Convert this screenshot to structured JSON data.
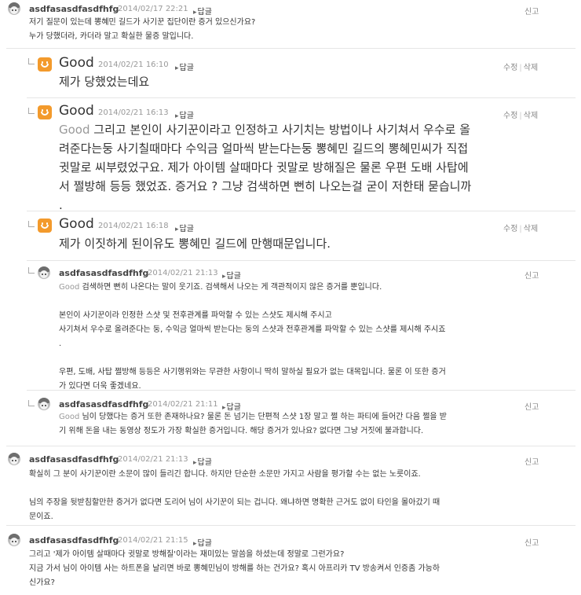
{
  "comments": [
    {
      "nick": "asdfasasdfasdfhfg",
      "date": "2014/02/17 22:21",
      "reply": "답글",
      "report": "신고",
      "lines": [
        "저기 질문이 있는데 뽕혜민 길드가 사기꾼 집단이란 증거 있으신가요?",
        "누가 당했더라, 카더라 말고 확실한 물증 말입니다."
      ]
    },
    {
      "nick": "Good",
      "date": "2014/02/21 16:10",
      "reply": "답글",
      "edit": "수정",
      "delete": "삭제",
      "lines": [
        "제가 당했었는데요"
      ]
    },
    {
      "nick": "Good",
      "date": "2014/02/21 16:13",
      "reply": "답글",
      "edit": "수정",
      "delete": "삭제",
      "mention": "Good",
      "lines": [
        " 그리고 본인이 사기꾼이라고 인정하고 사기치는 방법이나 사기쳐서 우수로 올",
        "려준다는둥 사기칠때마다 수익금 얼마씩 받는다는둥 뽕혜민 길드의 뽕혜민씨가 직접",
        "귓말로 씨부렸었구요. 제가 아이템 살때마다 귓말로 방해질은 물론 우편 도배 사탑에",
        "서 쩔방해 등등 했었죠. 증거요 ? 그냥 검색하면 뻔히 나오는걸 굳이 저한태 묻습니까",
        "."
      ]
    },
    {
      "nick": "Good",
      "date": "2014/02/21 16:18",
      "reply": "답글",
      "edit": "수정",
      "delete": "삭제",
      "lines": [
        "제가 이짓하게 된이유도 뽕혜민 길드에 만행때문입니다."
      ]
    },
    {
      "nick": "asdfasasdfasdfhfg",
      "date": "2014/02/21 21:13",
      "reply": "답글",
      "report": "신고",
      "mention": "Good",
      "lines": [
        " 검색하면 뻔히 나온다는 말이 웃기죠. 검색해서 나오는 게 객관적이지 않은 증거를 뿐입니다.",
        "",
        "본인이 사기꾼이라 인정한 스샷 및 전후관계를 파악할 수 있는 스샷도 제시해 주시고",
        "사기쳐서 우수로 올려준다는 둥, 수익금 얼마씩 받는다는 둥의 스샷과 전후관계를 파악할 수 있는 스샷를 제시해 주시죠",
        ".",
        "",
        "우편, 도배, 사탑 쩔방해 등등은 사기행위와는 무관한 사항이니 딱히 말하실 필요가 없는 대목입니다. 물론 이 또한 증거",
        "가 있다면 더욱 좋겠네요."
      ]
    },
    {
      "nick": "asdfasasdfasdfhfg",
      "date": "2014/02/21 21:11",
      "reply": "답글",
      "report": "신고",
      "mention": "Good",
      "lines": [
        " 님이 당했다는 증거 또한 존재하나요? 물론 돈 넘기는 단편적 스샷 1장 말고 쩔 하는 파티에 들어간 다음 쩔을 받",
        "기 위해 돈을 내는 동영상 정도가 가장 확실한 증거입니다. 해당 증거가 있나요? 없다면 그냥 거짓에 불과합니다."
      ]
    },
    {
      "nick": "asdfasasdfasdfhfg",
      "date": "2014/02/21 21:13",
      "reply": "답글",
      "report": "신고",
      "lines": [
        "확실히 그 분이 사기꾼이란 소문이 많이 들리긴 합니다. 하지만 단순한 소문만 가지고 사람을 평가할 수는 없는 노릇이죠.",
        "",
        "님의 주장을 뒷받침할만한 증거가 없다면 도리어 님이 사기꾼이 되는 겁니다. 왜냐하면 명확한 근거도 없이 타인을 몰아갔기 때",
        "문이죠."
      ]
    },
    {
      "nick": "asdfasasdfasdfhfg",
      "date": "2014/02/21 21:15",
      "reply": "답글",
      "report": "신고",
      "lines": [
        "그리고 '제가 아이템 살때마다 귓말로 방해질'이라는 재미있는 말씀을 하셨는데 정말로 그런가요?",
        "지금 가서 님이 아이템 사는 하트폰을 날리면 바로 뽕혜민님이 방해를 하는 건가요? 혹시 아프리카 TV 방송켜서 인증좀 가능하",
        "신가요?"
      ]
    }
  ]
}
